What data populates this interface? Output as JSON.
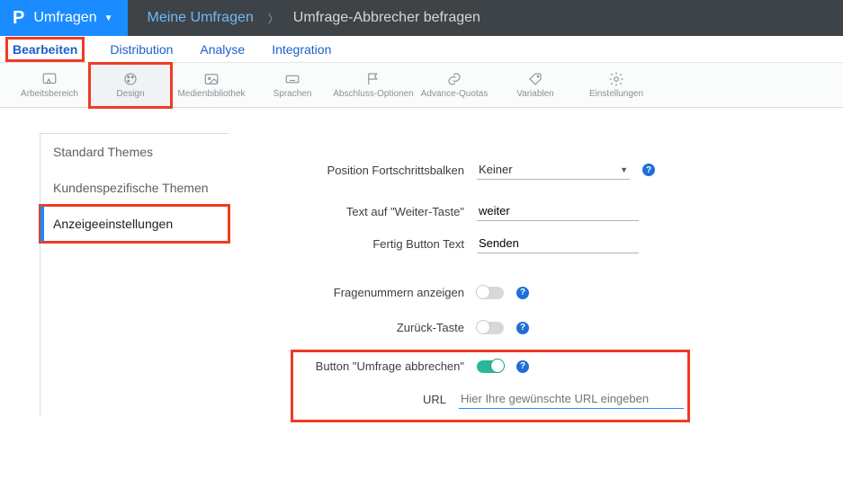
{
  "topbar": {
    "brand_label": "Umfragen",
    "breadcrumb_link": "Meine Umfragen",
    "breadcrumb_current": "Umfrage-Abbrecher befragen"
  },
  "subnav": {
    "items": [
      "Bearbeiten",
      "Distribution",
      "Analyse",
      "Integration"
    ],
    "active_index": 0
  },
  "toolbar": {
    "items": [
      {
        "label": "Arbeitsbereich"
      },
      {
        "label": "Design"
      },
      {
        "label": "Medienbibliothek"
      },
      {
        "label": "Sprachen"
      },
      {
        "label": "Abschluss-Optionen"
      },
      {
        "label": "Advance-Quotas"
      },
      {
        "label": "Variablen"
      },
      {
        "label": "Einstellungen"
      }
    ]
  },
  "sidemenu": {
    "items": [
      "Standard Themes",
      "Kundenspezifische Themen",
      "Anzeigeeinstellungen"
    ],
    "selected_index": 2
  },
  "form": {
    "progress_label": "Position Fortschrittsbalken",
    "progress_value": "Keiner",
    "next_text_label": "Text auf \"Weiter-Taste\"",
    "next_text_value": "weiter",
    "done_text_label": "Fertig Button Text",
    "done_text_value": "Senden",
    "show_numbers_label": "Fragenummern anzeigen",
    "show_numbers_on": false,
    "back_label": "Zurück-Taste",
    "back_on": false,
    "abort_label": "Button \"Umfrage abbrechen\"",
    "abort_on": true,
    "url_label": "URL",
    "url_placeholder": "Hier Ihre gewünschte URL eingeben"
  },
  "icons": {
    "help": "?"
  }
}
